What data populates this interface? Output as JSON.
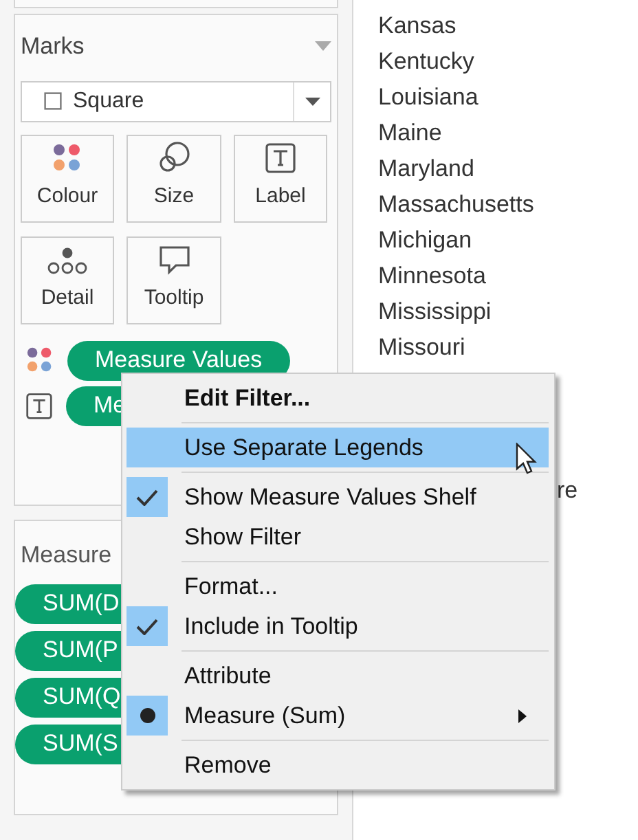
{
  "marks_card": {
    "title": "Marks",
    "mark_type": {
      "value": "Square"
    },
    "buttons": [
      {
        "kind": "colour",
        "label": "Colour"
      },
      {
        "kind": "size",
        "label": "Size"
      },
      {
        "kind": "label",
        "label": "Label"
      },
      {
        "kind": "detail",
        "label": "Detail"
      },
      {
        "kind": "tooltip",
        "label": "Tooltip"
      }
    ],
    "pills": [
      {
        "kind": "colour",
        "text": "Measure Values"
      },
      {
        "kind": "label",
        "text": "Me"
      }
    ]
  },
  "measure_values_card": {
    "title": "Measure",
    "pills": [
      "SUM(D",
      "SUM(P",
      "SUM(Q",
      "SUM(S"
    ]
  },
  "states_list": [
    "Kansas",
    "Kentucky",
    "Louisiana",
    "Maine",
    "Maryland",
    "Massachusetts",
    "Michigan",
    "Minnesota",
    "Mississippi",
    "Missouri"
  ],
  "states_list_partial": "re",
  "context_menu": {
    "groups": [
      [
        {
          "label": "Edit Filter...",
          "kind": "check",
          "checked": false,
          "highlighted": false,
          "default": true,
          "submenu": false
        }
      ],
      [
        {
          "label": "Use Separate Legends",
          "kind": "check",
          "checked": false,
          "highlighted": true,
          "default": false,
          "submenu": false
        }
      ],
      [
        {
          "label": "Show Measure Values Shelf",
          "kind": "check",
          "checked": true,
          "highlighted": false,
          "default": false,
          "submenu": false
        },
        {
          "label": "Show Filter",
          "kind": "check",
          "checked": false,
          "highlighted": false,
          "default": false,
          "submenu": false
        }
      ],
      [
        {
          "label": "Format...",
          "kind": "check",
          "checked": false,
          "highlighted": false,
          "default": false,
          "submenu": false
        },
        {
          "label": "Include in Tooltip",
          "kind": "check",
          "checked": true,
          "highlighted": false,
          "default": false,
          "submenu": false
        }
      ],
      [
        {
          "label": "Attribute",
          "kind": "radio",
          "checked": false,
          "highlighted": false,
          "default": false,
          "submenu": false
        },
        {
          "label": "Measure (Sum)",
          "kind": "radio",
          "checked": true,
          "highlighted": false,
          "default": false,
          "submenu": true
        }
      ],
      [
        {
          "label": "Remove",
          "kind": "check",
          "checked": false,
          "highlighted": false,
          "default": false,
          "submenu": false
        }
      ]
    ]
  }
}
